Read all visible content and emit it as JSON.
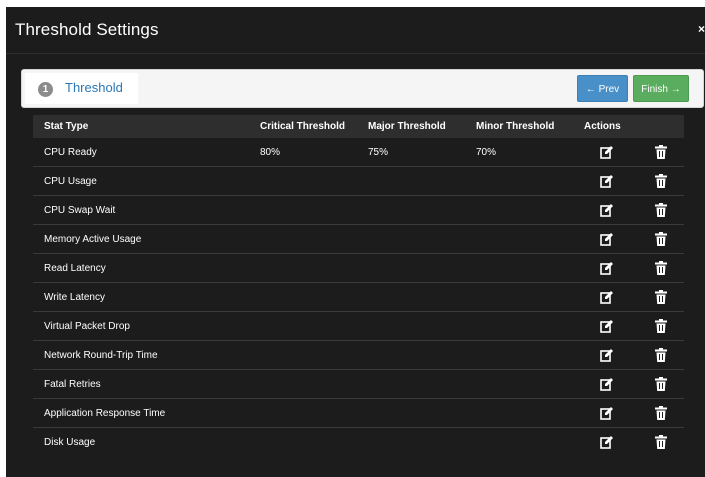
{
  "modal": {
    "title": "Threshold Settings",
    "close_label": "×"
  },
  "wizard": {
    "step_number": "1",
    "step_label": "Threshold",
    "prev_label": "← Prev",
    "finish_label": "Finish →"
  },
  "table": {
    "headers": [
      "Stat Type",
      "Critical Threshold",
      "Major Threshold",
      "Minor Threshold",
      "Actions"
    ],
    "rows": [
      {
        "stat": "CPU Ready",
        "critical": "80%",
        "major": "75%",
        "minor": "70%"
      },
      {
        "stat": "CPU Usage",
        "critical": "",
        "major": "",
        "minor": ""
      },
      {
        "stat": "CPU Swap Wait",
        "critical": "",
        "major": "",
        "minor": ""
      },
      {
        "stat": "Memory Active Usage",
        "critical": "",
        "major": "",
        "minor": ""
      },
      {
        "stat": "Read Latency",
        "critical": "",
        "major": "",
        "minor": ""
      },
      {
        "stat": "Write Latency",
        "critical": "",
        "major": "",
        "minor": ""
      },
      {
        "stat": "Virtual Packet Drop",
        "critical": "",
        "major": "",
        "minor": ""
      },
      {
        "stat": "Network Round-Trip Time",
        "critical": "",
        "major": "",
        "minor": ""
      },
      {
        "stat": "Fatal Retries",
        "critical": "",
        "major": "",
        "minor": ""
      },
      {
        "stat": "Application Response Time",
        "critical": "",
        "major": "",
        "minor": ""
      },
      {
        "stat": "Disk Usage",
        "critical": "",
        "major": "",
        "minor": ""
      }
    ],
    "row_icons": {
      "edit": "edit-icon",
      "delete": "trash-icon"
    }
  },
  "colors": {
    "background": "#1c1c1c",
    "link": "#2a78b8",
    "prev_button": "#4a90c8",
    "finish_button": "#5aad5e"
  }
}
